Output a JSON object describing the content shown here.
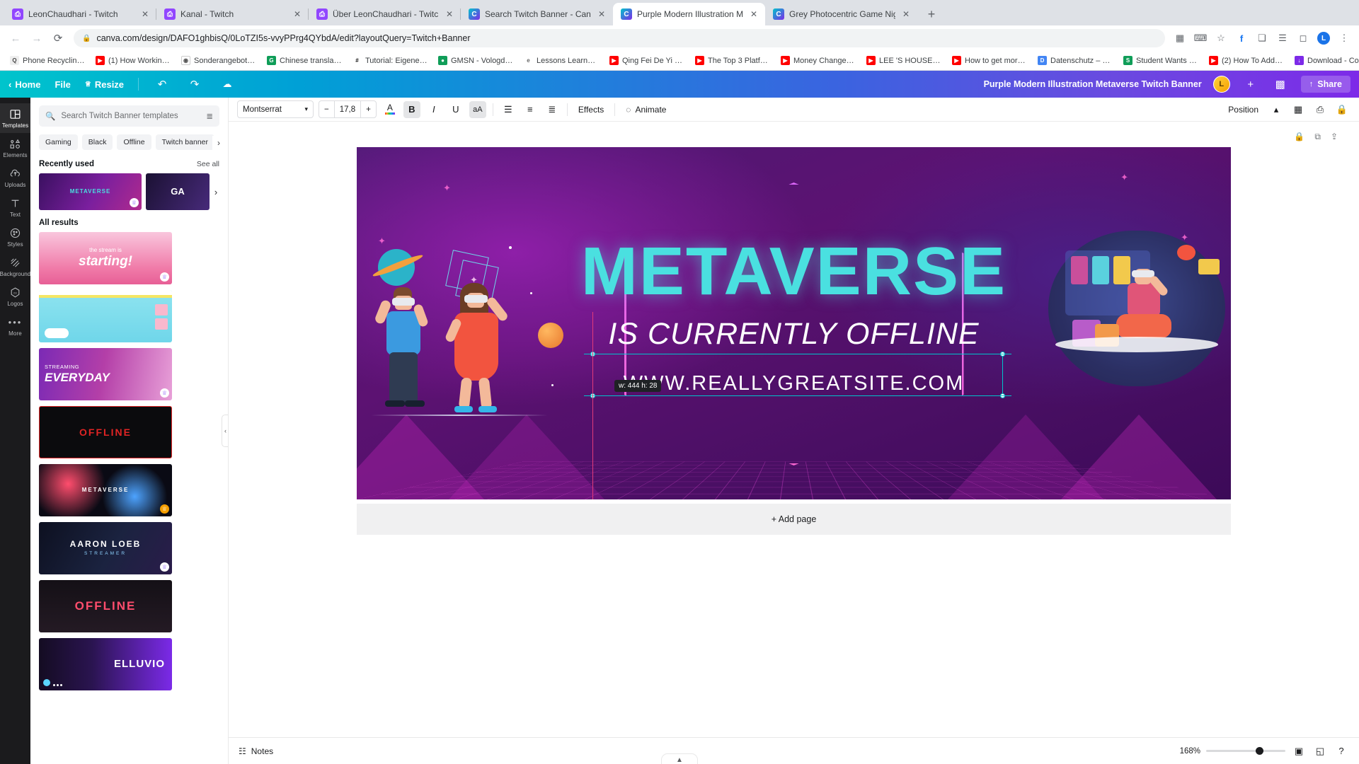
{
  "browser": {
    "tabs": [
      {
        "title": "LeonChaudhari - Twitch",
        "favicon": "twitch-icon",
        "active": false
      },
      {
        "title": "Kanal - Twitch",
        "favicon": "twitch-icon",
        "active": false
      },
      {
        "title": "Über LeonChaudhari - Twitch",
        "favicon": "twitch-icon",
        "active": false
      },
      {
        "title": "Search Twitch Banner - Canva",
        "favicon": "canva-icon",
        "active": false
      },
      {
        "title": "Purple Modern Illustration Met",
        "favicon": "canva-icon",
        "active": true
      },
      {
        "title": "Grey Photocentric Game Night",
        "favicon": "canva-icon",
        "active": false
      }
    ],
    "new_tab_label": "+",
    "close_label": "✕",
    "nav": {
      "back": "←",
      "forward": "→",
      "reload": "⟳"
    },
    "url": "canva.com/design/DAFO1ghbisQ/0LoTZI5s-vvyPPrg4QYbdA/edit?layoutQuery=Twitch+Banner",
    "lock_icon": "lock-icon",
    "omnibox_actions": [
      "apps-icon",
      "translate-icon",
      "star-icon",
      "facebook-icon",
      "puzzle-icon",
      "list-icon",
      "cast-icon"
    ],
    "profile_initial": "L",
    "menu_icon": "⋮",
    "bookmarks": [
      {
        "label": "Phone Recycling...",
        "color": "#ffffff",
        "glyph": "Q"
      },
      {
        "label": "(1) How Working a...",
        "color": "#ff0000",
        "glyph": "▶"
      },
      {
        "label": "Sonderangebot! |...",
        "color": "#ffffff",
        "glyph": "◎"
      },
      {
        "label": "Chinese translatio...",
        "color": "#0f9d58",
        "glyph": "G"
      },
      {
        "label": "Tutorial: Eigene Fa...",
        "color": "#1b1b1b",
        "glyph": "#"
      },
      {
        "label": "GMSN - Vologda...",
        "color": "#0f9d58",
        "glyph": "◉"
      },
      {
        "label": "Lessons Learned f...",
        "color": "#ffffff",
        "glyph": "e*"
      },
      {
        "label": "Qing Fei De Yi - Y...",
        "color": "#ff0000",
        "glyph": "▶"
      },
      {
        "label": "The Top 3 Platfor...",
        "color": "#ff0000",
        "glyph": "▶"
      },
      {
        "label": "Money Changes E...",
        "color": "#ff0000",
        "glyph": "▶"
      },
      {
        "label": "LEE 'S HOUSE—...",
        "color": "#ff0000",
        "glyph": "▶"
      },
      {
        "label": "How to get more v...",
        "color": "#ff0000",
        "glyph": "▶"
      },
      {
        "label": "Datenschutz – Re...",
        "color": "#4285f4",
        "glyph": "D"
      },
      {
        "label": "Student Wants an...",
        "color": "#0f9d58",
        "glyph": "S"
      },
      {
        "label": "(2) How To Add A...",
        "color": "#ff0000",
        "glyph": "▶"
      },
      {
        "label": "Download - Cooki...",
        "color": "#7d2ae8",
        "glyph": "↓"
      }
    ]
  },
  "canva": {
    "header": {
      "back_icon": "chevron-left-icon",
      "home_label": "Home",
      "file_label": "File",
      "resize_label": "Resize",
      "resize_icon": "crown-icon",
      "undo_icon": "undo-icon",
      "redo_icon": "redo-icon",
      "cloud_icon": "cloud-saved-icon",
      "design_title": "Purple Modern Illustration Metaverse Twitch Banner",
      "avatar_initial": "L",
      "add_member_label": "+",
      "insights_icon": "bar-chart-icon",
      "share_label": "Share",
      "share_icon": "share-icon"
    },
    "rail": [
      {
        "label": "Templates",
        "icon": "templates-icon",
        "active": true
      },
      {
        "label": "Elements",
        "icon": "elements-icon",
        "active": false
      },
      {
        "label": "Uploads",
        "icon": "uploads-icon",
        "active": false
      },
      {
        "label": "Text",
        "icon": "text-icon",
        "active": false
      },
      {
        "label": "Styles",
        "icon": "styles-icon",
        "active": false
      },
      {
        "label": "Background",
        "icon": "background-icon",
        "active": false
      },
      {
        "label": "Logos",
        "icon": "logos-icon",
        "active": false
      },
      {
        "label": "More",
        "icon": "more-icon",
        "active": false
      }
    ],
    "panel": {
      "search_placeholder": "Search Twitch Banner templates",
      "search_icon": "search-icon",
      "filter_icon": "filter-icon",
      "chips": [
        "Gaming",
        "Black",
        "Offline",
        "Twitch banner"
      ],
      "chips_more_icon": "chevron-right-icon",
      "recent_title": "Recently used",
      "see_all_label": "See all",
      "recent_next_icon": "chevron-right-icon",
      "recent_items": [
        {
          "name": "metaverse-banner-thumb",
          "label": "METAVERSE"
        },
        {
          "name": "gaming-banner-thumb",
          "label": "GA"
        }
      ],
      "results_title": "All results",
      "templates": [
        {
          "name": "stream-starting-pink",
          "line1": "the stream is",
          "line2": "starting!"
        },
        {
          "name": "blue-cloud-offline",
          "line1": "",
          "line2": ""
        },
        {
          "name": "streaming-everyday",
          "line1": "STREAMING",
          "line2": "EVERYDAY"
        },
        {
          "name": "red-offline-neon",
          "line1": "",
          "line2": "OFFLINE"
        },
        {
          "name": "metaverse-space",
          "line1": "METAVERSE",
          "line2": ""
        },
        {
          "name": "aaron-loeb-streamer",
          "line1": "AARON LOEB",
          "line2": "STREAMER"
        },
        {
          "name": "offline-dark",
          "line1": "OFFLINE",
          "line2": ""
        },
        {
          "name": "elluvio-purple",
          "line1": "ELLUVIO",
          "line2": ""
        }
      ],
      "collapse_icon": "chevron-left-icon"
    },
    "format_bar": {
      "font_name": "Montserrat",
      "font_dropdown_icon": "chevron-down-icon",
      "size_minus": "−",
      "font_size": "17,8",
      "size_plus": "+",
      "text_color_label": "A",
      "bold_label": "B",
      "italic_label": "I",
      "underline_label": "U",
      "case_label": "aA",
      "align_icon": "align-left-icon",
      "list_icon": "bullet-list-icon",
      "spacing_icon": "line-spacing-icon",
      "effects_label": "Effects",
      "animate_label": "Animate",
      "animate_icon": "animate-icon",
      "position_label": "Position",
      "transparency_icon": "transparency-icon",
      "grid_icon": "grid-icon",
      "copy_style_icon": "copy-style-icon",
      "lock_icon": "lock-icon"
    },
    "canvas_tools": [
      "lock-icon",
      "duplicate-icon",
      "more-icon"
    ],
    "banner": {
      "title": "METAVERSE",
      "subtitle": "IS CURRENTLY OFFLINE",
      "url": "WWW.REALLYGREATSITE.COM",
      "selection_tooltip": "w: 444 h: 28",
      "title_color": "#4ae0e0",
      "background_color": "#5c1272",
      "accent_color": "#ff6ad5"
    },
    "add_page_label": "+ Add page",
    "bottom": {
      "notes_label": "Notes",
      "notes_icon": "notes-icon",
      "zoom_level": "168%",
      "pages_icon": "page-manager-icon",
      "fullscreen_icon": "fullscreen-icon",
      "help_icon": "help-icon",
      "collapse_icon": "chevron-up-icon"
    }
  }
}
